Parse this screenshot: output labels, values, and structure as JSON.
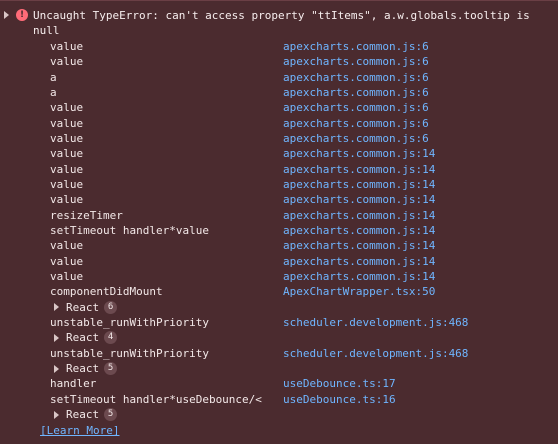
{
  "console": {
    "error_icon": "error-icon",
    "error_icon_glyph": "!",
    "error_text": "Uncaught TypeError: can't access property \"ttItems\", a.w.globals.tooltip is null",
    "stack": [
      {
        "type": "frame",
        "fn": "value",
        "loc": "apexcharts.common.js:6"
      },
      {
        "type": "frame",
        "fn": "value",
        "loc": "apexcharts.common.js:6"
      },
      {
        "type": "frame",
        "fn": "a",
        "loc": "apexcharts.common.js:6"
      },
      {
        "type": "frame",
        "fn": "a",
        "loc": "apexcharts.common.js:6"
      },
      {
        "type": "frame",
        "fn": "value",
        "loc": "apexcharts.common.js:6"
      },
      {
        "type": "frame",
        "fn": "value",
        "loc": "apexcharts.common.js:6"
      },
      {
        "type": "frame",
        "fn": "value",
        "loc": "apexcharts.common.js:6"
      },
      {
        "type": "frame",
        "fn": "value",
        "loc": "apexcharts.common.js:14"
      },
      {
        "type": "frame",
        "fn": "value",
        "loc": "apexcharts.common.js:14"
      },
      {
        "type": "frame",
        "fn": "value",
        "loc": "apexcharts.common.js:14"
      },
      {
        "type": "frame",
        "fn": "value",
        "loc": "apexcharts.common.js:14"
      },
      {
        "type": "frame",
        "fn": "resizeTimer",
        "loc": "apexcharts.common.js:14"
      },
      {
        "type": "frame",
        "fn": "setTimeout handler*value",
        "loc": "apexcharts.common.js:14"
      },
      {
        "type": "frame",
        "fn": "value",
        "loc": "apexcharts.common.js:14"
      },
      {
        "type": "frame",
        "fn": "value",
        "loc": "apexcharts.common.js:14"
      },
      {
        "type": "frame",
        "fn": "value",
        "loc": "apexcharts.common.js:14"
      },
      {
        "type": "frame",
        "fn": "componentDidMount",
        "loc": "ApexChartWrapper.tsx:50"
      },
      {
        "type": "group",
        "label": "React",
        "count": "6"
      },
      {
        "type": "frame",
        "fn": "unstable_runWithPriority",
        "loc": "scheduler.development.js:468"
      },
      {
        "type": "group",
        "label": "React",
        "count": "4"
      },
      {
        "type": "frame",
        "fn": "unstable_runWithPriority",
        "loc": "scheduler.development.js:468"
      },
      {
        "type": "group",
        "label": "React",
        "count": "5"
      },
      {
        "type": "frame",
        "fn": "handler",
        "loc": "useDebounce.ts:17"
      },
      {
        "type": "frame",
        "fn": "setTimeout handler*useDebounce/<",
        "loc": "useDebounce.ts:16"
      },
      {
        "type": "group",
        "label": "React",
        "count": "5"
      }
    ],
    "learn_more": "[Learn More]"
  },
  "colors": {
    "background": "#4b2b2f",
    "link": "#6fb5ff",
    "text": "#f3e8e8",
    "error_icon": "#ff6b78"
  }
}
